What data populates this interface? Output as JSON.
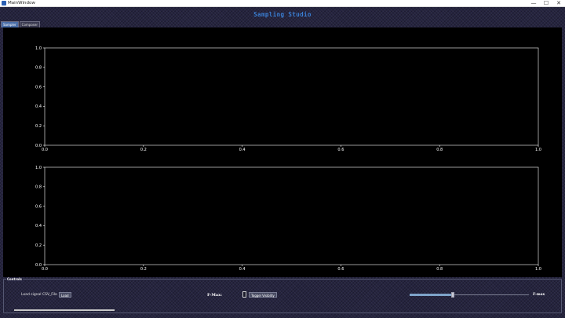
{
  "window": {
    "title": "MainWindow",
    "minimize": "—",
    "maximize": "☐",
    "close": "✕"
  },
  "app": {
    "title": "Sampling Studio"
  },
  "tabs": [
    {
      "label": "Sampler"
    },
    {
      "label": "Composer"
    }
  ],
  "plots": [
    {
      "xticks": [
        "0.0",
        "0.2",
        "0.4",
        "0.6",
        "0.8",
        "1.0"
      ],
      "yticks": [
        "0.0",
        "0.2",
        "0.4",
        "0.6",
        "0.8",
        "1.0"
      ],
      "xlim": [
        0,
        1
      ],
      "ylim": [
        0,
        1
      ]
    },
    {
      "xticks": [
        "0.0",
        "0.2",
        "0.4",
        "0.6",
        "0.8",
        "1.0"
      ],
      "yticks": [
        "0.0",
        "0.2",
        "0.4",
        "0.6",
        "0.8",
        "1.0"
      ],
      "xlim": [
        0,
        1
      ],
      "ylim": [
        0,
        1
      ]
    }
  ],
  "controls": {
    "title": "Controls",
    "load_label": "Load signal CSV_File",
    "load_button": "Load",
    "fmax_left": "F-Max:",
    "toggle_button": "Toggel Visiblity",
    "slider_value": 0.36,
    "fmax_right": "F-max"
  },
  "colors": {
    "accent": "#3a7fd4",
    "background": "#25243f",
    "plot_bg": "#000000",
    "axis": "#ffffff"
  }
}
